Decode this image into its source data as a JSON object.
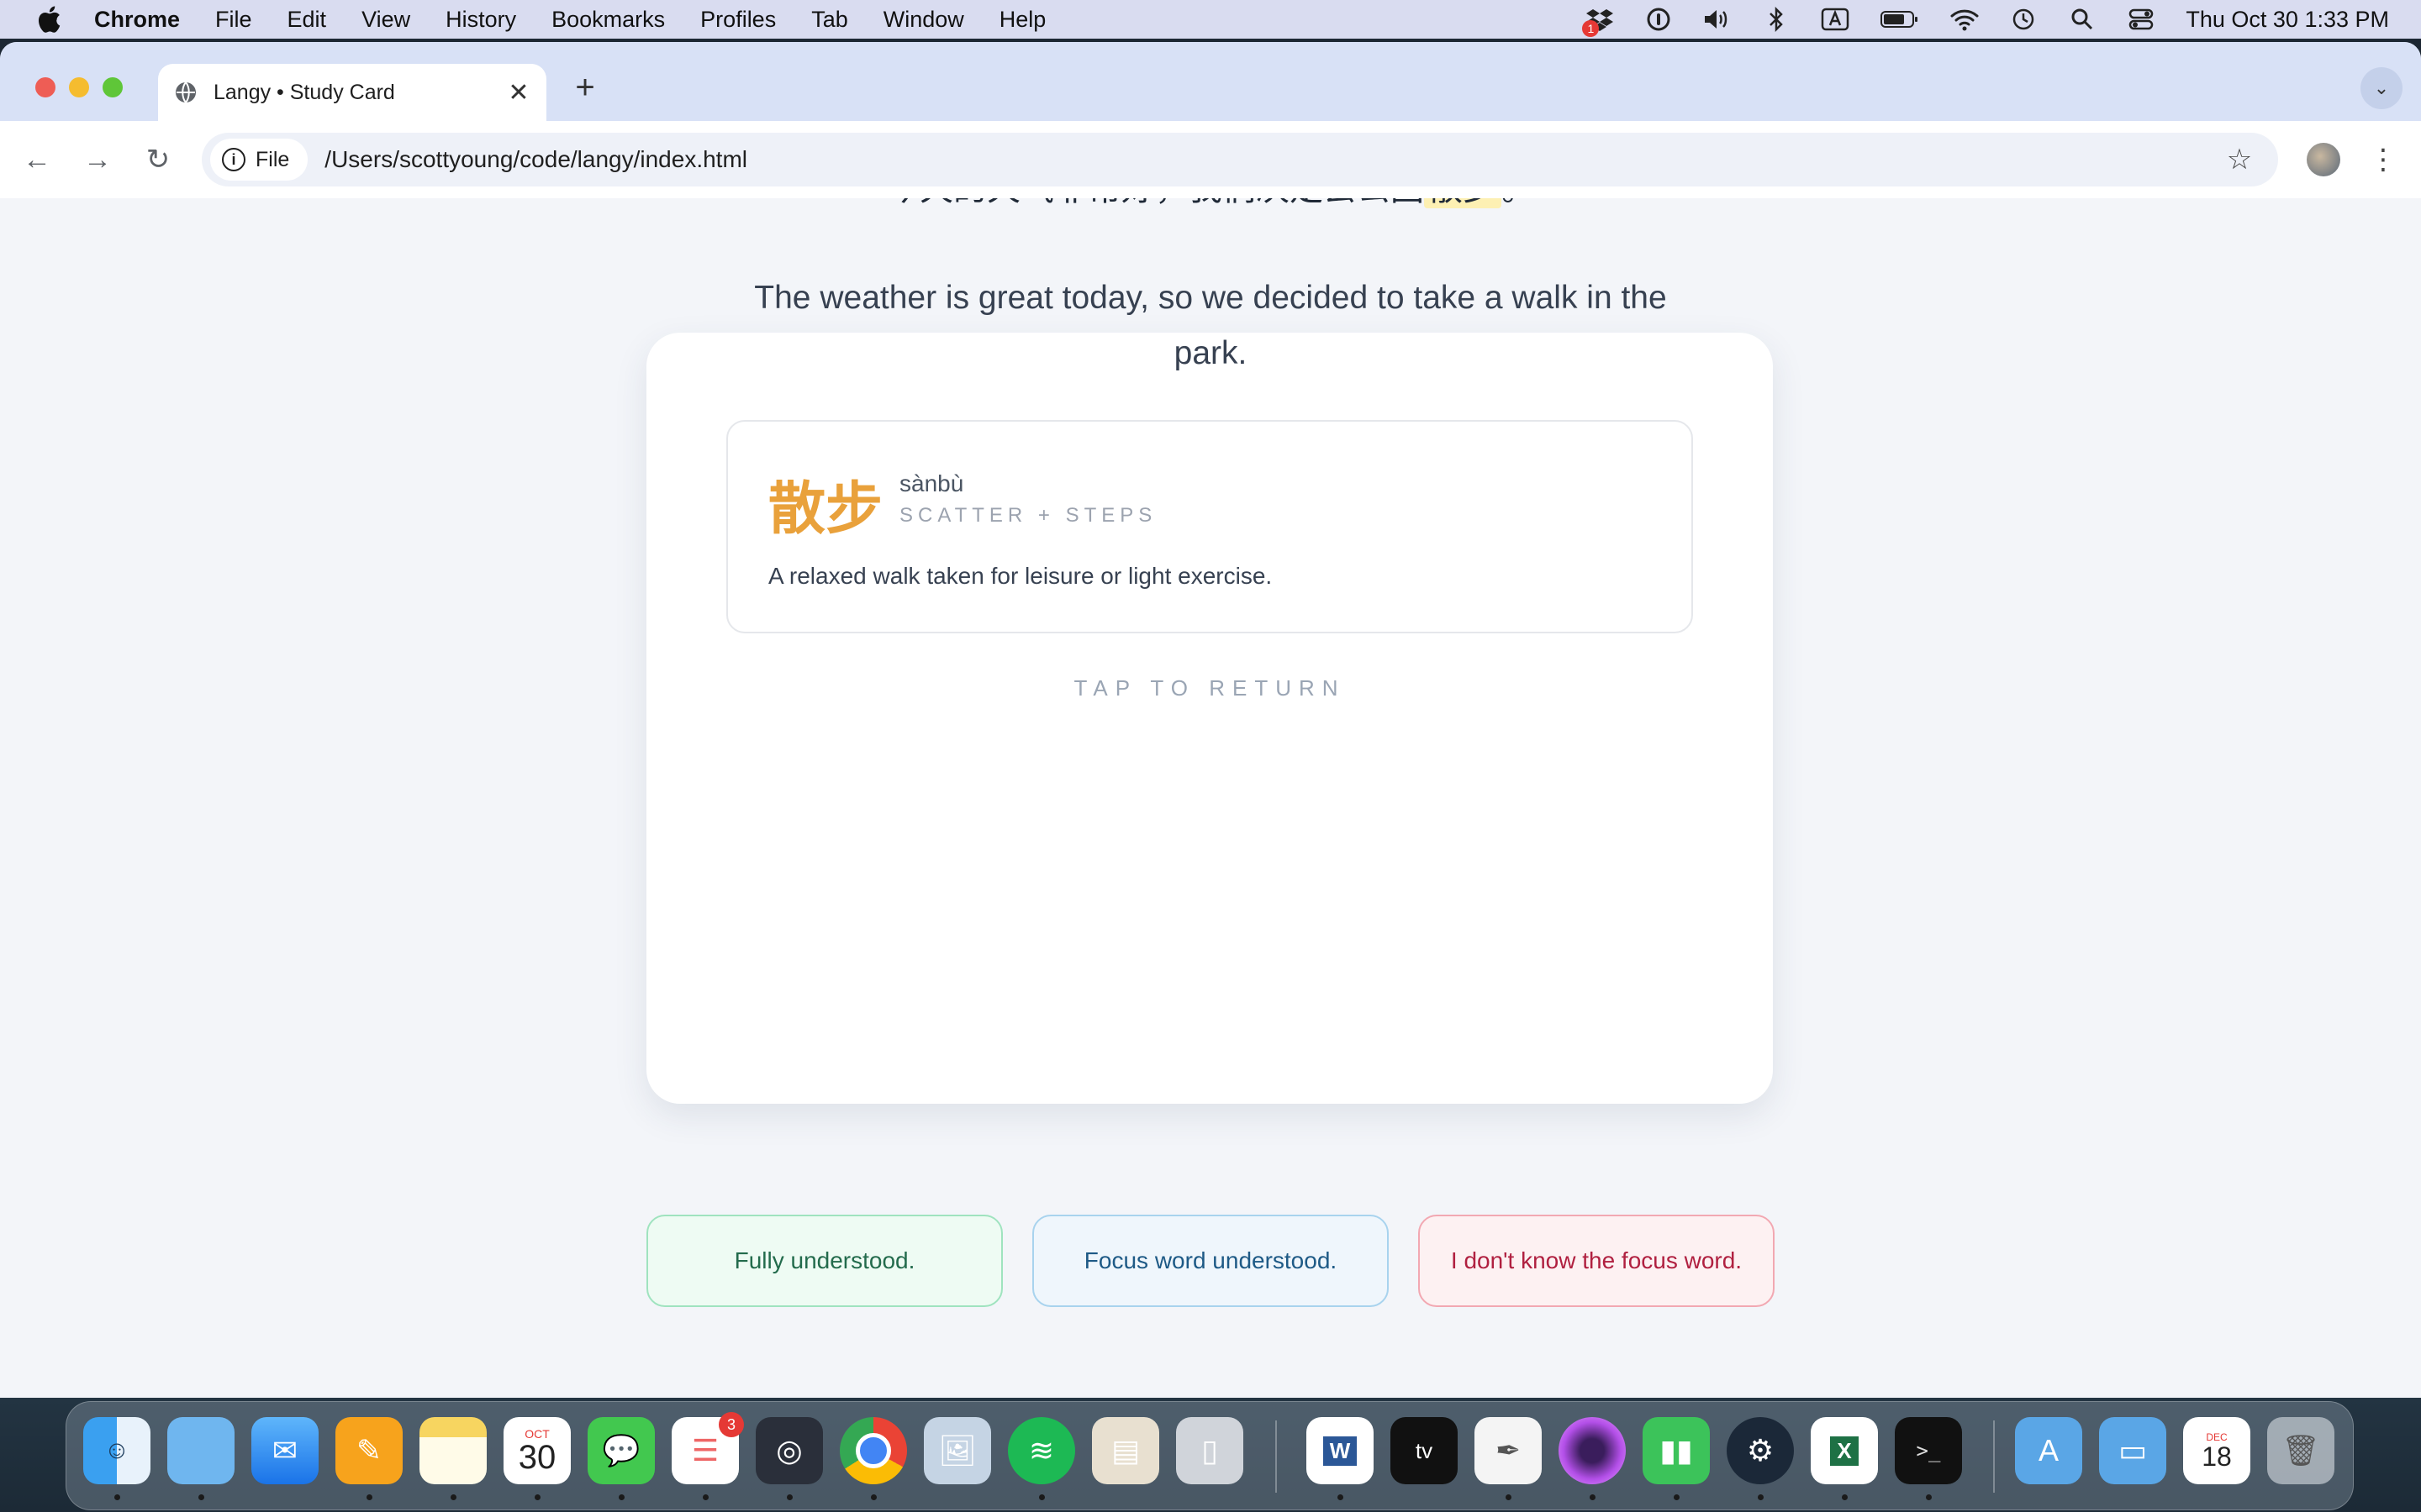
{
  "menubar": {
    "app": "Chrome",
    "items": [
      "File",
      "Edit",
      "View",
      "History",
      "Bookmarks",
      "Profiles",
      "Tab",
      "Window",
      "Help"
    ],
    "clock": "Thu Oct 30  1:33 PM"
  },
  "browser": {
    "tab_title": "Langy • Study Card",
    "url_chip": "File",
    "url": "/Users/scottyoung/code/langy/index.html"
  },
  "card": {
    "sentence_zh_before": "今天的天气非常好，我们决定去公园",
    "sentence_zh_focus": "散步",
    "sentence_zh_after": "。",
    "sentence_en": "The weather is great today, so we decided to take a walk in the park.",
    "word": "散步",
    "pinyin": "sànbù",
    "gloss": "SCATTER + STEPS",
    "definition": "A relaxed walk taken for leisure or light exercise.",
    "tap_hint": "TAP TO RETURN"
  },
  "ratings": {
    "full": "Fully understood.",
    "focus": "Focus word understood.",
    "unknown": "I don't know the focus word."
  },
  "dock": {
    "calendar_month": "OCT",
    "calendar_day": "30",
    "reminders_badge": "3",
    "dropbox_badge": "1",
    "doc_month": "DEC",
    "doc_day": "18"
  },
  "colors": {
    "focus_word": "#e9a13b",
    "highlight": "#fdf0b3",
    "btn_full_text": "#236b4c",
    "btn_focus_text": "#1e5a86",
    "btn_unknown_text": "#b02040"
  }
}
